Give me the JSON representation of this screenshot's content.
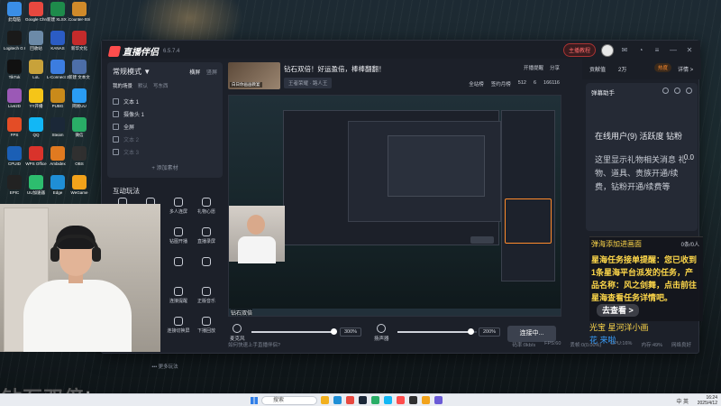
{
  "desktop": {
    "icons": [
      {
        "label": "此电脑",
        "color": "#3a8ee6"
      },
      {
        "label": "Google Chrome",
        "color": "#e8483f"
      },
      {
        "label": "新建 XLSX 工作表",
        "color": "#1e8b4b"
      },
      {
        "label": "Counter-Strike",
        "color": "#d08a2a"
      },
      {
        "label": "Logitech G HUB",
        "color": "#1a1a1a"
      },
      {
        "label": "回收站",
        "color": "#6c8aa8"
      },
      {
        "label": "KANAS",
        "color": "#2b5cc4"
      },
      {
        "label": "新华文化",
        "color": "#c42b2b"
      },
      {
        "label": "TikTok",
        "color": "#111111"
      },
      {
        "label": "LoL",
        "color": "#c8a23a"
      },
      {
        "label": "L-Connect 3",
        "color": "#3c7de0"
      },
      {
        "label": "新建 文本文档",
        "color": "#4d6fa8"
      },
      {
        "label": "Live2D",
        "color": "#9b59b6"
      },
      {
        "label": "YY开播",
        "color": "#f5c518"
      },
      {
        "label": "PUBG",
        "color": "#c98a1a"
      },
      {
        "label": "网易UU",
        "color": "#2a9df4"
      },
      {
        "label": "FPS",
        "color": "#e44d26"
      },
      {
        "label": "QQ",
        "color": "#12b7f5"
      },
      {
        "label": "Steam",
        "color": "#1b2838"
      },
      {
        "label": "微信",
        "color": "#2aae67"
      },
      {
        "label": "CPUID",
        "color": "#1b5fb5"
      },
      {
        "label": "WPS Office",
        "color": "#d9332b"
      },
      {
        "label": "Ambidex",
        "color": "#e07a20"
      },
      {
        "label": "OBS",
        "color": "#303030"
      },
      {
        "label": "EPIC",
        "color": "#222222"
      },
      {
        "label": "UU加速器",
        "color": "#2dbd6e"
      },
      {
        "label": "Edge",
        "color": "#1f8fd6"
      },
      {
        "label": "WeGame",
        "color": "#f2a31b"
      },
      {
        "label": "腾讯会议",
        "color": "#3a6ee8"
      },
      {
        "label": "新建 文本",
        "color": "#c24141"
      },
      {
        "label": "ASUS",
        "color": "#6b7fa8"
      },
      {
        "label": "鲁大师",
        "color": "#f0a020"
      }
    ]
  },
  "app": {
    "name": "直播伴侣",
    "version": "6.5.7.4",
    "host_btn": "主播教程",
    "titlebar_icons": [
      "message-icon",
      "notification-icon",
      "menu-icon",
      "minimize-icon",
      "close-icon"
    ],
    "left": {
      "mode": "常规模式 ▼",
      "mode_tabs": [
        "横屏",
        "竖屏"
      ],
      "scene_tabs": [
        "我的场景",
        "默认",
        "写东西"
      ],
      "sources": [
        {
          "label": "文本 1",
          "dim": false
        },
        {
          "label": "摄像头 1",
          "dim": false
        },
        {
          "label": "全屏",
          "dim": false
        },
        {
          "label": "文本 2",
          "dim": true
        },
        {
          "label": "文本 3",
          "dim": true
        }
      ],
      "add_source": "+ 添加素材",
      "interaction_title": "互动玩法",
      "play_items": [
        "连线",
        "安全",
        "多人连屏",
        "礼物心愿",
        "",
        "",
        "钻图开播",
        "直播录屏",
        "弹幕秀",
        "榜单",
        "",
        "",
        "弹幕秀",
        "背景助手",
        "连接提醒",
        "正版音乐",
        "弹幕秀",
        "背景助手",
        "连接切换屏",
        "下播回放"
      ],
      "more_play": "••• 更多玩法"
    },
    "center": {
      "thumb_label": "白日你画画教宴",
      "room_title": "钻石双倍！好运盈倍，棒棒翻翻！",
      "room_tag": "王者荣耀 · 路人王",
      "top_actions": [
        "开播提醒",
        "分享"
      ],
      "stats": [
        {
          "label": "全站榜",
          "red": false
        },
        {
          "label": "签约月榜",
          "red": false
        },
        {
          "label": "512",
          "red": false
        },
        {
          "label": "6",
          "red": false
        },
        {
          "label": "166116",
          "red": false
        }
      ],
      "preview_label": "钻石双倍",
      "mic_label": "麦克风",
      "mic_volume": "300%",
      "speaker_label": "扬声器",
      "speaker_volume": "200%",
      "tools": [
        "美颜",
        "录制",
        "设置"
      ],
      "connect": "连接中..."
    },
    "status": {
      "left": "如何快速上手直播伴侣?",
      "items": [
        "码率:0kb/s",
        "FPS:60",
        "丢帧:0(0.00%)",
        "CPU:16%",
        "内存:49%",
        "网络良好"
      ]
    },
    "right": {
      "tab_labels": [
        "贡献值",
        "2万"
      ],
      "hot": "热度",
      "more": "详情 >",
      "danmu_title": "弹幕助手",
      "user_tabs": "在线用户(9)  活跃度  钻粉",
      "coin": "0.0",
      "notice": "这里显示礼物相关消息 礼物、道具、贵族开通/续费，钻粉开通/续费等"
    },
    "task": {
      "title": "弹海添加进画面",
      "count": "0条/0人",
      "body": "星海任务接单提醒：您已收到1条星海平台派发的任务，产品名称：风之剑舞，点击前往星海查看任务详情吧。",
      "go_btn": "去查看 >"
    },
    "chat": [
      {
        "text": "光宝   星河洋小画",
        "style": "y"
      },
      {
        "text": "花 来啦",
        "style": "b"
      }
    ]
  },
  "watermark": "钻石双倍!",
  "taskbar": {
    "search": "搜索",
    "tray": "中 英",
    "time": "16:24",
    "date": "2025/4/12"
  }
}
